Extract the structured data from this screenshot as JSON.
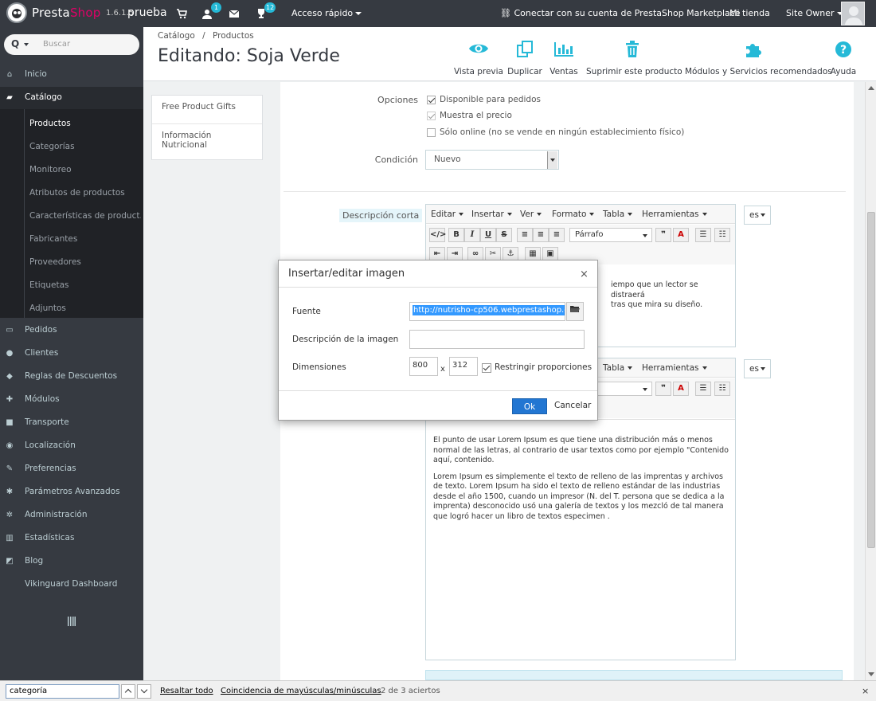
{
  "topbar": {
    "brand_presta": "Presta",
    "brand_shop": "Shop",
    "version": "1.6.1.5",
    "shop_name": "prueba",
    "orders_badge": "",
    "customers_badge": "1",
    "messages_badge": "",
    "notifications_badge": "12",
    "quick_access": "Acceso rápido",
    "marketplace": "Conectar con su cuenta de PrestaShop Marketplace",
    "my_store": "Mi tienda",
    "user": "Site Owner"
  },
  "sidebar": {
    "search_prefix": "Q",
    "search_placeholder": "Buscar",
    "items": [
      {
        "label": "Inicio",
        "icon": "home-icon"
      },
      {
        "label": "Catálogo",
        "icon": "book-icon"
      },
      {
        "label": "Pedidos",
        "icon": "credit-card-icon"
      },
      {
        "label": "Clientes",
        "icon": "users-icon"
      },
      {
        "label": "Reglas de Descuentos",
        "icon": "tag-icon"
      },
      {
        "label": "Módulos",
        "icon": "puzzle-icon"
      },
      {
        "label": "Transporte",
        "icon": "truck-icon"
      },
      {
        "label": "Localización",
        "icon": "globe-icon"
      },
      {
        "label": "Preferencias",
        "icon": "wrench-icon"
      },
      {
        "label": "Parámetros Avanzados",
        "icon": "cogs-icon"
      },
      {
        "label": "Administración",
        "icon": "cog-icon"
      },
      {
        "label": "Estadísticas",
        "icon": "bar-chart-icon"
      },
      {
        "label": "Blog",
        "icon": "pencil-icon"
      },
      {
        "label": "Vikinguard Dashboard",
        "icon": ""
      }
    ],
    "submenu": [
      "Productos",
      "Categorías",
      "Monitoreo",
      "Atributos de productos",
      "Características de product...",
      "Fabricantes",
      "Proveedores",
      "Etiquetas",
      "Adjuntos"
    ]
  },
  "header": {
    "breadcrumb_root": "Catálogo",
    "breadcrumb_sep": "/",
    "breadcrumb_current": "Productos",
    "title": "Editando: Soja Verde",
    "tools": [
      {
        "label": "Vista previa",
        "icon": "eye-icon"
      },
      {
        "label": "Duplicar",
        "icon": "copy-icon"
      },
      {
        "label": "Ventas",
        "icon": "bar-chart-icon"
      },
      {
        "label": "Suprimir este producto",
        "icon": "trash-icon"
      },
      {
        "label": "Módulos y Servicios recomendados",
        "icon": "puzzle-icon"
      },
      {
        "label": "Ayuda",
        "icon": "help-icon"
      }
    ]
  },
  "tabs": [
    "Free Product Gifts",
    "Información Nutricional"
  ],
  "form": {
    "options_label": "Opciones",
    "options": [
      {
        "label": "Disponible para pedidos",
        "checked": true
      },
      {
        "label": "Muestra el precio",
        "checked": true
      },
      {
        "label": "Sólo online (no se vende en ningún establecimiento físico)",
        "checked": false
      }
    ],
    "condition_label": "Condición",
    "condition_value": "Nuevo",
    "short_desc_label": "Descripción corta",
    "lang": "es"
  },
  "editor": {
    "menus": [
      "Editar",
      "Insertar",
      "Ver",
      "Formato",
      "Tabla",
      "Herramientas"
    ],
    "menus2": [
      "Tabla",
      "Herramientas"
    ],
    "format_select": "Párrafo",
    "format_select2": "fo",
    "toolbar": [
      "</>",
      "B",
      "I",
      "U",
      "S"
    ],
    "short_text_1": "iempo que un lector se distraerá",
    "short_text_2": "tras que mira su diseño.",
    "body_p1": "El punto de usar Lorem Ipsum es que tiene una distribución más o menos normal de las letras, al contrario de usar textos como por ejemplo \"Contenido aquí, contenido.",
    "body_p2": "Lorem Ipsum es simplemente el texto de relleno de las imprentas y archivos de texto. Lorem Ipsum ha sido el texto de relleno estándar de las industrias desde el año 1500, cuando un impresor (N. del T. persona que se dedica a la imprenta) desconocido usó una galería de textos y los mezcló de tal manera que logró hacer un libro de textos especimen  ."
  },
  "modal": {
    "title": "Insertar/editar imagen",
    "close": "×",
    "source_label": "Fuente",
    "source_value": "http://nutrisho-cp506.webprestashop.c",
    "desc_label": "Descripción de la imagen",
    "desc_value": "",
    "dims_label": "Dimensiones",
    "width": "800",
    "times": "x",
    "height": "312",
    "constrain_label": "Restringir proporciones",
    "ok": "Ok",
    "cancel": "Cancelar"
  },
  "findbar": {
    "query": "categoría",
    "highlight_all": "Resaltar todo",
    "match_case": "Coincidencia de mayúsculas/minúsculas",
    "count": "2 de 3 aciertos",
    "close": "×"
  },
  "colors": {
    "sidebar_bg": "#363a41",
    "accent": "#25b9d7",
    "brand_pink": "#df0067",
    "ok_blue": "#2276d2"
  }
}
